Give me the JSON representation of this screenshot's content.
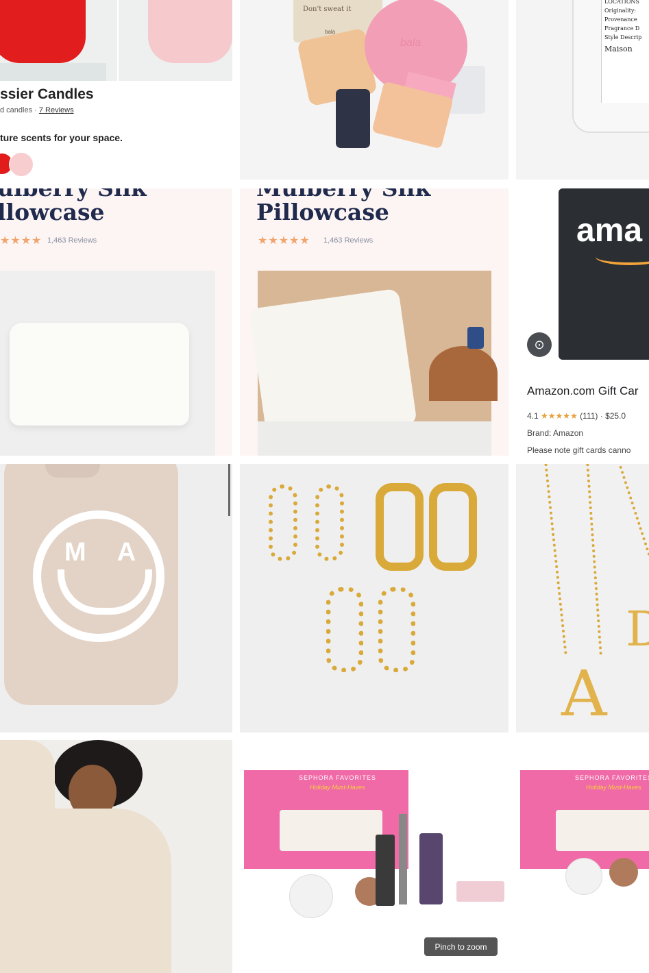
{
  "candle_card": {
    "title": "ssier Candles",
    "subtitle": "d candles · ",
    "reviews_link": "7 Reviews",
    "description": "ture scents for your space."
  },
  "pouch_card": {
    "pouch_text": "Don't sweat it",
    "pouch_brand": "bala",
    "ball_brand": "bala"
  },
  "perfume_card": {
    "label_lines": [
      "LOCATIONS",
      "Originality:",
      "Provenance",
      "Fragrance D",
      "Style Descrip",
      "Maison"
    ]
  },
  "pillow_left": {
    "title_line1": "ulberry Silk",
    "title_line2": "llowcase",
    "stars": "★★★★",
    "reviews": "1,463 Reviews"
  },
  "pillow_right": {
    "title_line1": "Mulberry Silk",
    "title_line2": "Pillowcase",
    "stars": "★★★★★",
    "reviews": "1,463 Reviews"
  },
  "amazon_card": {
    "logo_text": "ama",
    "title": "Amazon.com Gift Car",
    "rating_value": "4.1",
    "stars": "★★★★★",
    "rating_count": "(111)",
    "price": "$25.0",
    "brand": "Brand: Amazon",
    "note": "Please note gift cards canno"
  },
  "phone_case": {
    "initials": "M A"
  },
  "necklace": {
    "initial": "A",
    "initial2": "D"
  },
  "makeup_box": {
    "brand": "SEPHORA FAVORITES",
    "subtitle": "Holiday Must-Haves"
  },
  "pinch_to_zoom": "Pinch to zoom",
  "colors": {
    "navy": "#1f2a4d",
    "red_candle": "#e21b1b",
    "pink_candle": "#f8cdd0",
    "gold": "#d9a93a",
    "sephora_pink": "#f06aa8"
  }
}
